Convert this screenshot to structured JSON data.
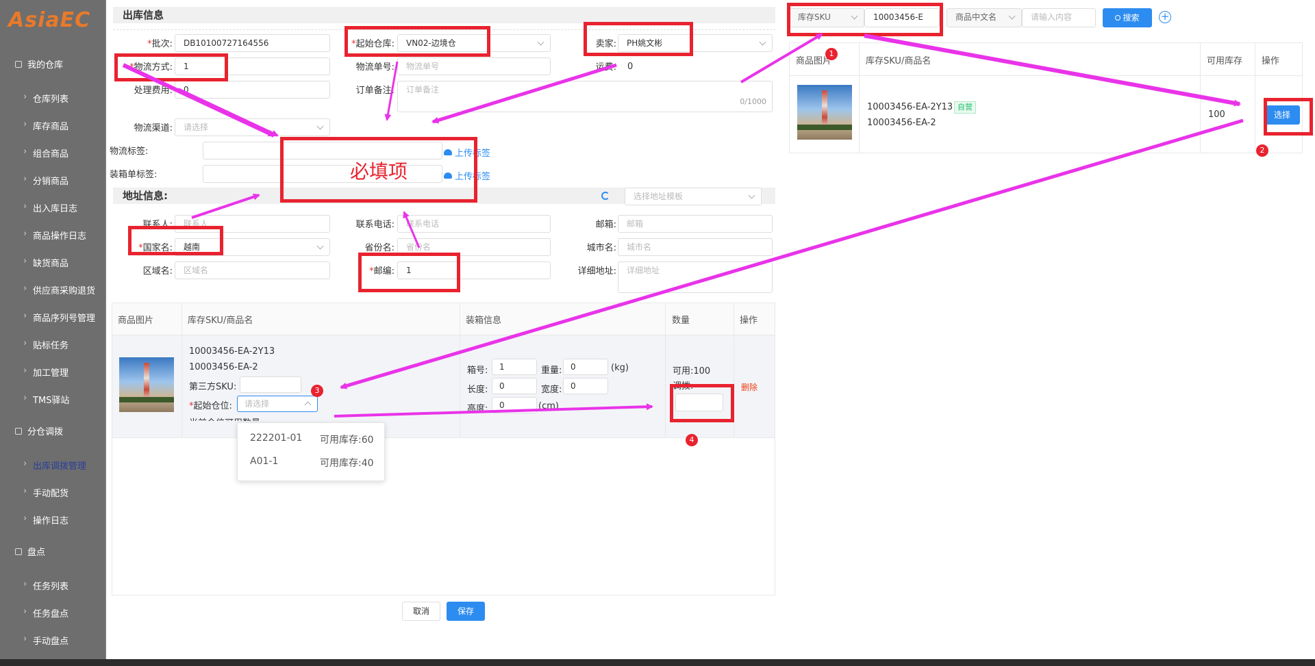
{
  "sidebar": {
    "logo": "AsiaEC",
    "groups": [
      {
        "label": "我的仓库"
      },
      {
        "label": "分仓调拨"
      },
      {
        "label": "盘点"
      }
    ],
    "items": [
      "仓库列表",
      "库存商品",
      "组合商品",
      "分销商品",
      "出入库日志",
      "商品操作日志",
      "缺货商品",
      "供应商采购退货",
      "商品序列号管理",
      "贴标任务",
      "加工管理",
      "TMS驿站",
      "出库调拨管理",
      "手动配货",
      "操作日志",
      "任务列表",
      "任务盘点",
      "手动盘点"
    ]
  },
  "colors": {
    "accent": "#2d8cf0",
    "annotation": "#e8232f",
    "arrow": "#e933e9"
  },
  "outbound": {
    "title": "出库信息",
    "batch_label": "批次:",
    "batch_value": "DB10100727164556",
    "warehouse_label": "起始仓库:",
    "warehouse_value": "VN02-边境仓",
    "seller_label": "卖家:",
    "seller_value": "PH姚文彬",
    "logistics_mode_label": "物流方式:",
    "logistics_mode_value": "1",
    "tracking_label": "物流单号:",
    "tracking_placeholder": "物流单号",
    "freight_label": "运费:",
    "freight_value": "0",
    "fee_label": "处理费用:",
    "fee_value": "0",
    "remark_label": "订单备注:",
    "remark_placeholder": "订单备注",
    "remark_count": "0/1000",
    "channel_label": "物流渠道:",
    "channel_placeholder": "请选择",
    "label_label": "物流标签:",
    "packing_label": "装箱单标签:",
    "upload_text": "上传标签",
    "required_note": "必填项"
  },
  "address": {
    "title": "地址信息:",
    "template_placeholder": "选择地址模板",
    "contact_label": "联系人:",
    "contact_placeholder": "联系人",
    "phone_label": "联系电话:",
    "phone_placeholder": "联系电话",
    "email_label": "邮箱:",
    "email_placeholder": "邮箱",
    "country_label": "国家名:",
    "country_value": "越南",
    "province_label": "省份名:",
    "province_placeholder": "省份名",
    "city_label": "城市名:",
    "city_placeholder": "城市名",
    "district_label": "区域名:",
    "district_placeholder": "区域名",
    "zip_label": "邮编:",
    "zip_value": "1",
    "detail_label": "详细地址:",
    "detail_placeholder": "详细地址"
  },
  "goods_table": {
    "headers": [
      "商品图片",
      "库存SKU/商品名",
      "装箱信息",
      "数量",
      "操作"
    ],
    "sku1": "10003456-EA-2Y13",
    "sku2": "10003456-EA-2",
    "third_sku_label": "第三方SKU:",
    "start_loc_label": "起始仓位:",
    "start_loc_placeholder": "请选择",
    "current_qty_label": "当前仓位可用数量:",
    "box_label": "箱号:",
    "box_value": "1",
    "weight_label": "重量:",
    "weight_value": "0",
    "kg": "(kg)",
    "length_label": "长度:",
    "length_value": "0",
    "width_label": "宽度:",
    "width_value": "0",
    "height_label": "高度:",
    "height_value": "0",
    "cm": "(cm)",
    "available": "可用:100",
    "transfer_label": "调拨:",
    "delete": "删除"
  },
  "dropdown": {
    "options": [
      {
        "loc": "222201-01",
        "stock": "可用库存:60"
      },
      {
        "loc": "A01-1",
        "stock": "可用库存:40"
      }
    ]
  },
  "search": {
    "field_select": "库存SKU",
    "sku_value": "10003456-E",
    "name_select": "商品中文名",
    "name_placeholder": "请输入内容",
    "search_btn": "搜索"
  },
  "result_table": {
    "headers": [
      "商品图片",
      "库存SKU/商品名",
      "可用库存",
      "操作"
    ],
    "sku1": "10003456-EA-2Y13",
    "sku2": "10003456-EA-2",
    "tag": "自营",
    "stock": "100",
    "select_btn": "选择"
  },
  "footer": {
    "cancel": "取消",
    "save": "保存"
  },
  "badges": [
    "1",
    "2",
    "3",
    "4"
  ]
}
